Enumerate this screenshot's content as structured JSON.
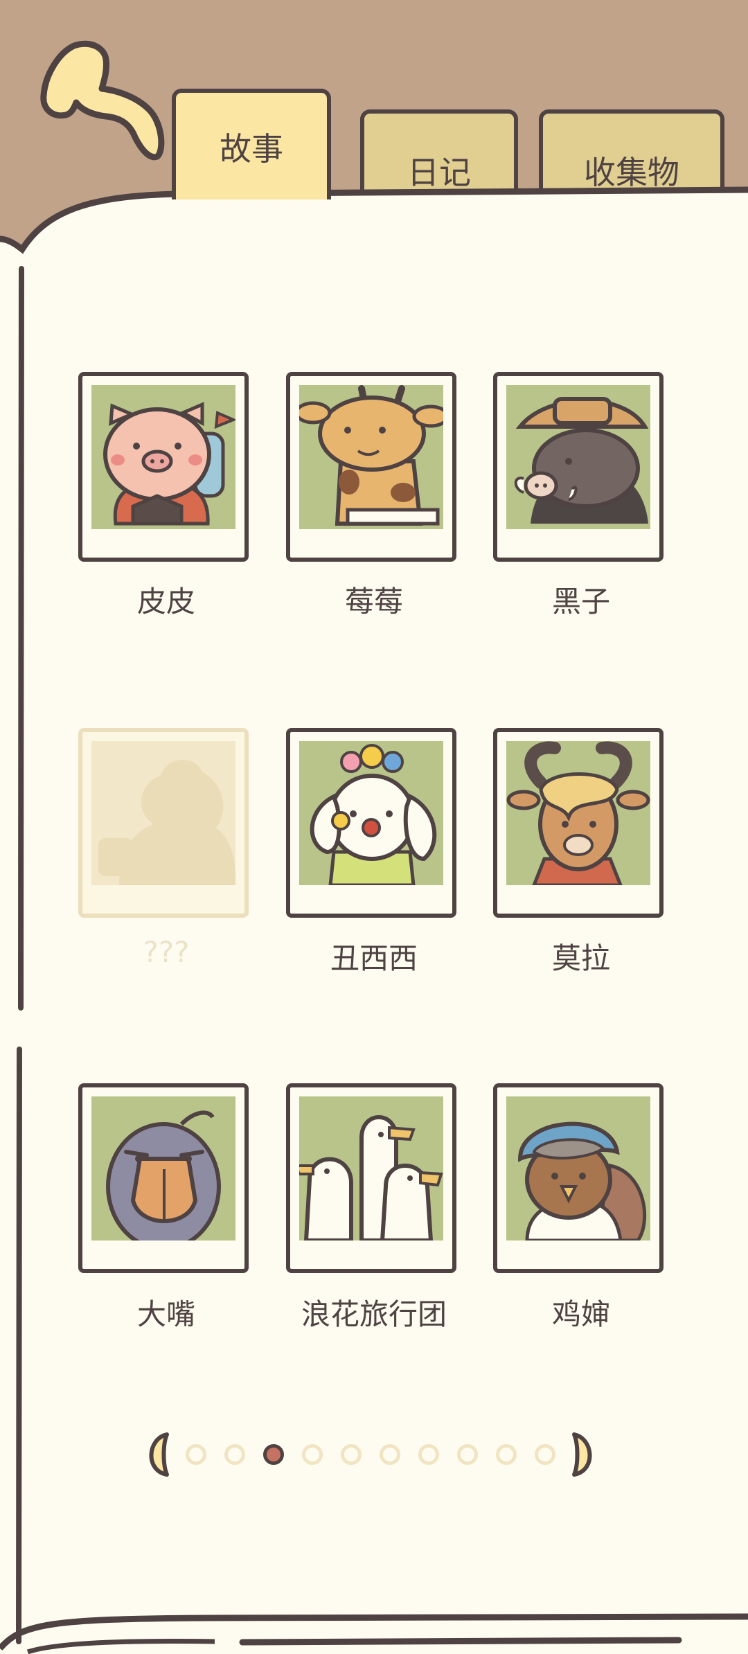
{
  "tabs": [
    {
      "label": "故事",
      "active": true
    },
    {
      "label": "日记",
      "active": false
    },
    {
      "label": "收集物",
      "active": false
    }
  ],
  "characters": [
    {
      "name": "皮皮",
      "locked": false,
      "icon": "pig-portrait"
    },
    {
      "name": "莓莓",
      "locked": false,
      "icon": "giraffe-portrait"
    },
    {
      "name": "黑子",
      "locked": false,
      "icon": "boar-portrait"
    },
    {
      "name": "???",
      "locked": true,
      "icon": "silhouette-portrait"
    },
    {
      "name": "丑西西",
      "locked": false,
      "icon": "clown-dog-portrait"
    },
    {
      "name": "莫拉",
      "locked": false,
      "icon": "goat-portrait"
    },
    {
      "name": "大嘴",
      "locked": false,
      "icon": "shoebill-portrait"
    },
    {
      "name": "浪花旅行团",
      "locked": false,
      "icon": "ducks-portrait"
    },
    {
      "name": "鸡婶",
      "locked": false,
      "icon": "hen-portrait"
    }
  ],
  "pager": {
    "pages": 10,
    "current": 3
  },
  "colors": {
    "frame": "#c1a38a",
    "page": "#fefcf0",
    "outline": "#4e4242",
    "accent_dot": "#c57262",
    "portrait_bg": "#b8c48a"
  }
}
